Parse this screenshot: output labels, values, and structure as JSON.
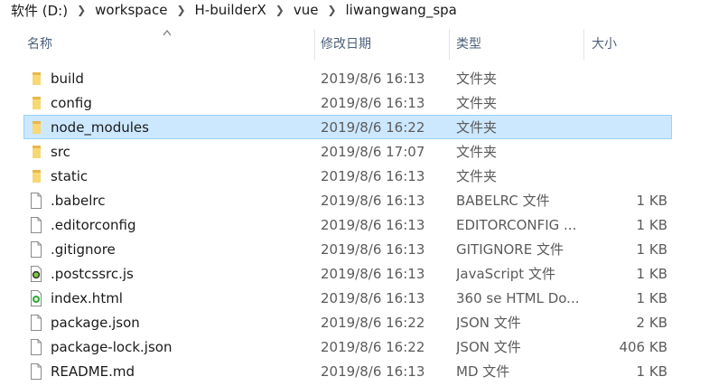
{
  "breadcrumb": [
    "软件 (D:)",
    "workspace",
    "H-builderX",
    "vue",
    "liwangwang_spa"
  ],
  "columns": {
    "name": "名称",
    "date": "修改日期",
    "type": "类型",
    "size": "大小"
  },
  "colors": {
    "folder": "#f8d775",
    "selected_bg": "#cce8ff",
    "selected_border": "#99d1ff",
    "header_text": "#4c607a"
  },
  "files": [
    {
      "name": "build",
      "date": "2019/8/6 16:13",
      "type": "文件夹",
      "size": "",
      "icon": "folder-icon"
    },
    {
      "name": "config",
      "date": "2019/8/6 16:13",
      "type": "文件夹",
      "size": "",
      "icon": "folder-icon"
    },
    {
      "name": "node_modules",
      "date": "2019/8/6 16:22",
      "type": "文件夹",
      "size": "",
      "icon": "folder-icon",
      "selected": true
    },
    {
      "name": "src",
      "date": "2019/8/6 17:07",
      "type": "文件夹",
      "size": "",
      "icon": "folder-icon"
    },
    {
      "name": "static",
      "date": "2019/8/6 16:13",
      "type": "文件夹",
      "size": "",
      "icon": "folder-icon"
    },
    {
      "name": ".babelrc",
      "date": "2019/8/6 16:13",
      "type": "BABELRC 文件",
      "size": "1 KB",
      "icon": "file-icon"
    },
    {
      "name": ".editorconfig",
      "date": "2019/8/6 16:13",
      "type": "EDITORCONFIG ...",
      "size": "1 KB",
      "icon": "file-icon"
    },
    {
      "name": ".gitignore",
      "date": "2019/8/6 16:13",
      "type": "GITIGNORE 文件",
      "size": "1 KB",
      "icon": "file-icon"
    },
    {
      "name": ".postcssrc.js",
      "date": "2019/8/6 16:13",
      "type": "JavaScript 文件",
      "size": "1 KB",
      "icon": "js-file-icon"
    },
    {
      "name": "index.html",
      "date": "2019/8/6 16:13",
      "type": "360 se HTML Do...",
      "size": "1 KB",
      "icon": "html-file-icon"
    },
    {
      "name": "package.json",
      "date": "2019/8/6 16:22",
      "type": "JSON 文件",
      "size": "2 KB",
      "icon": "file-icon"
    },
    {
      "name": "package-lock.json",
      "date": "2019/8/6 16:22",
      "type": "JSON 文件",
      "size": "406 KB",
      "icon": "file-icon"
    },
    {
      "name": "README.md",
      "date": "2019/8/6 16:13",
      "type": "MD 文件",
      "size": "1 KB",
      "icon": "file-icon"
    }
  ]
}
